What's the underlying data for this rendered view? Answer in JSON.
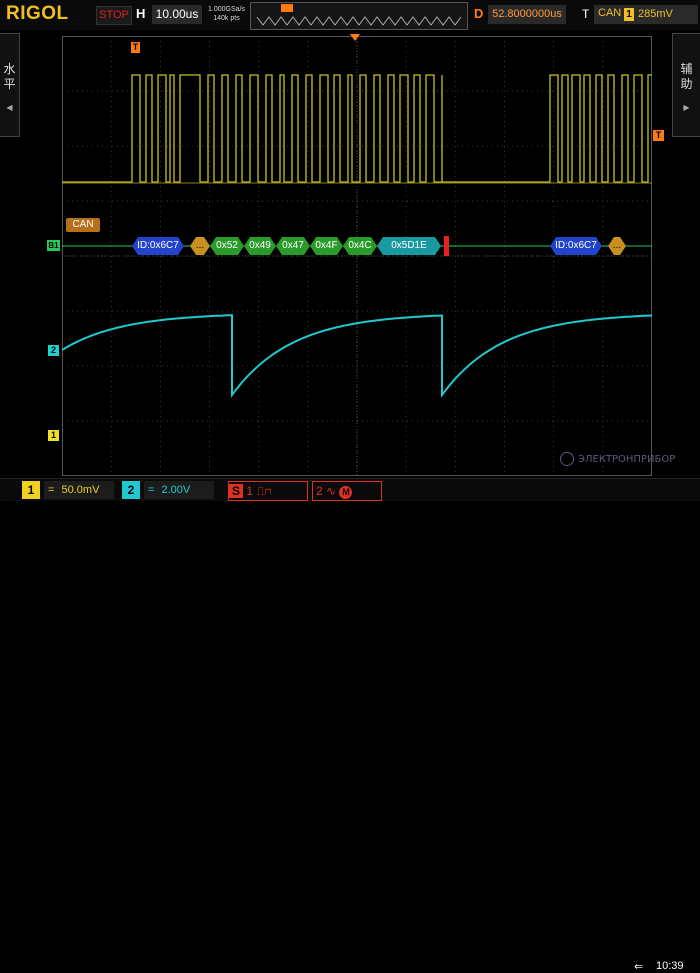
{
  "header": {
    "brand": "RIGOL",
    "run_state": "STOP",
    "timebase_label": "H",
    "timebase_value": "10.00us",
    "sample_rate": "1.000GSa/s",
    "memory_depth": "140k pts",
    "delay_label": "D",
    "delay_value": "52.8000000us",
    "trigger_label": "T",
    "trigger_type": "CAN",
    "trigger_source": "1",
    "trigger_level": "285mV"
  },
  "side": {
    "left_tab": [
      "水",
      "平"
    ],
    "right_tab": [
      "辅",
      "助"
    ]
  },
  "markers": {
    "trigger_pos": "T",
    "trigger_level_marker": "T",
    "bus_marker": "B1",
    "ch2_marker": "2",
    "ch1_marker": "1"
  },
  "decode": {
    "bus_name": "CAN",
    "packets": [
      {
        "type": "id",
        "label": "ID:0x6C7",
        "start": 132,
        "end": 184
      },
      {
        "type": "dlc",
        "label": "...",
        "start": 190,
        "end": 210
      },
      {
        "type": "data",
        "label": "0x52",
        "start": 210,
        "end": 244
      },
      {
        "type": "data",
        "label": "0x49",
        "start": 244,
        "end": 276
      },
      {
        "type": "data",
        "label": "0x47",
        "start": 276,
        "end": 310
      },
      {
        "type": "data",
        "label": "0x4F",
        "start": 310,
        "end": 343
      },
      {
        "type": "data",
        "label": "0x4C",
        "start": 343,
        "end": 377
      },
      {
        "type": "crc",
        "label": "0x5D1E",
        "start": 377,
        "end": 441
      },
      {
        "type": "id",
        "label": "ID:0x6C7",
        "start": 550,
        "end": 602
      },
      {
        "type": "dlc",
        "label": "...",
        "start": 608,
        "end": 626
      }
    ]
  },
  "footer": {
    "ch1_num": "1",
    "ch1_coupling": "=",
    "ch1_scale": "50.0mV",
    "ch2_num": "2",
    "ch2_coupling": "=",
    "ch2_scale": "2.00V",
    "s1_label": "S",
    "s1_num": "1",
    "s2_num": "2",
    "clock": "10:39",
    "watermark": "ЭЛЕКТРОНПРИБОР"
  },
  "colors": {
    "ch1": "#e0d020",
    "ch2": "#20c8d0",
    "bus": "#22cc55",
    "trigger": "#ff7a10"
  }
}
